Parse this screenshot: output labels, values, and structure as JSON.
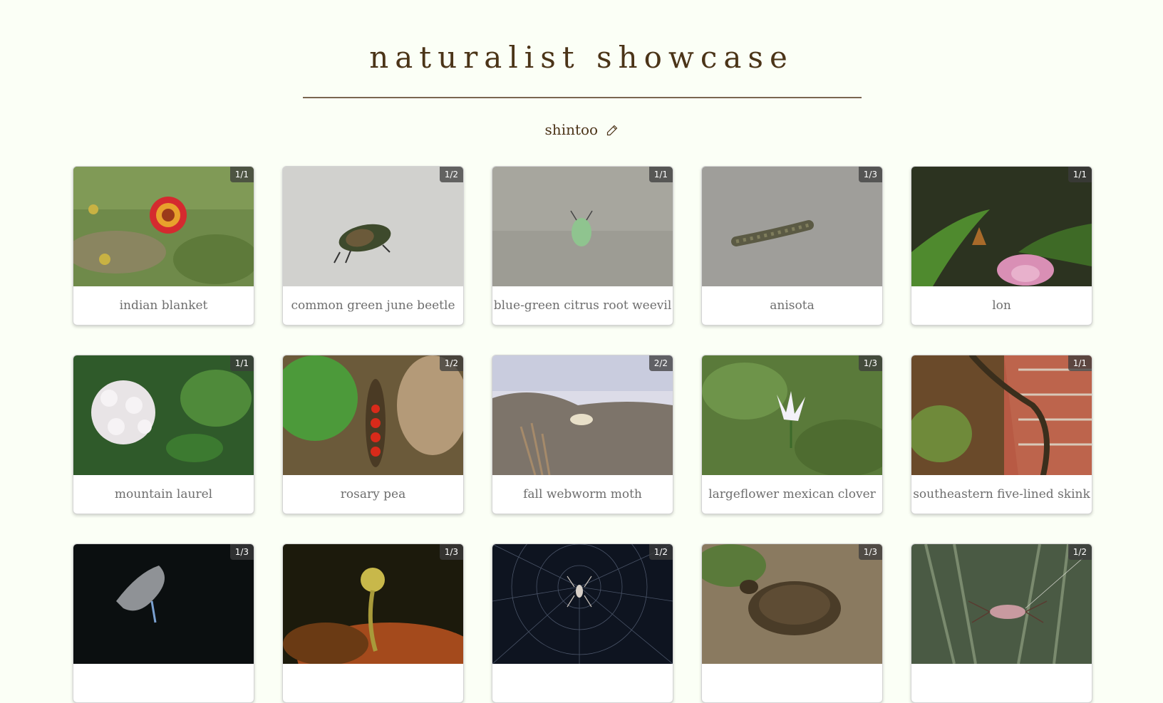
{
  "header": {
    "title": "naturalist showcase",
    "username": "shintoo"
  },
  "observations": [
    {
      "name": "indian blanket",
      "badge": "1/1"
    },
    {
      "name": "common green june beetle",
      "badge": "1/2"
    },
    {
      "name": "blue-green citrus root weevil",
      "badge": "1/1"
    },
    {
      "name": "anisota",
      "badge": "1/3"
    },
    {
      "name": "lon",
      "badge": "1/1"
    },
    {
      "name": "mountain laurel",
      "badge": "1/1"
    },
    {
      "name": "rosary pea",
      "badge": "1/2"
    },
    {
      "name": "fall webworm moth",
      "badge": "2/2"
    },
    {
      "name": "largeflower mexican clover",
      "badge": "1/3"
    },
    {
      "name": "southeastern five-lined skink",
      "badge": "1/1"
    },
    {
      "name": "",
      "badge": "1/3"
    },
    {
      "name": "",
      "badge": "1/3"
    },
    {
      "name": "",
      "badge": "1/2"
    },
    {
      "name": "",
      "badge": "1/3"
    },
    {
      "name": "",
      "badge": "1/2"
    }
  ],
  "icons": {
    "edit": "pencil-icon"
  },
  "colors": {
    "background": "#fbfff6",
    "title": "#4b3418",
    "rule": "#7a6650",
    "caption": "#6e6e6e"
  }
}
